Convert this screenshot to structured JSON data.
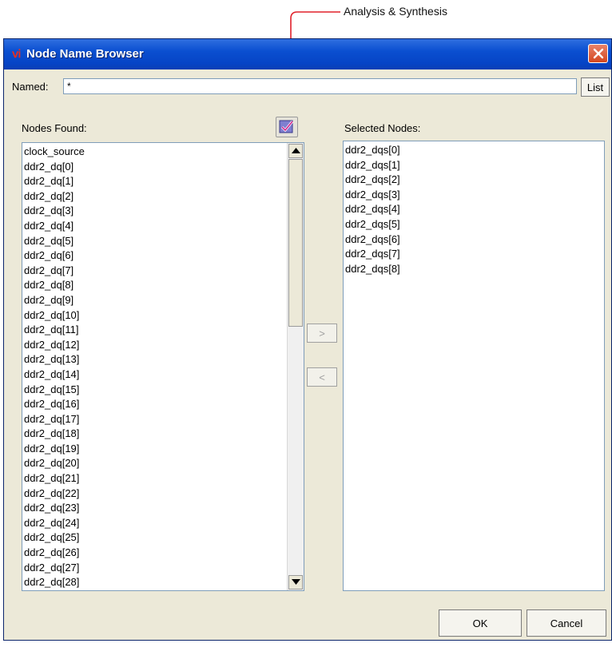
{
  "callout": {
    "label": "Analysis & Synthesis"
  },
  "window": {
    "title": "Node Name Browser",
    "app_icon": "quartus-icon",
    "close_icon": "close-icon"
  },
  "named": {
    "label": "Named:",
    "value": "*"
  },
  "list_button": {
    "label": "List"
  },
  "nodes_found": {
    "label": "Nodes Found:",
    "items": [
      "clock_source",
      "ddr2_dq[0]",
      "ddr2_dq[1]",
      "ddr2_dq[2]",
      "ddr2_dq[3]",
      "ddr2_dq[4]",
      "ddr2_dq[5]",
      "ddr2_dq[6]",
      "ddr2_dq[7]",
      "ddr2_dq[8]",
      "ddr2_dq[9]",
      "ddr2_dq[10]",
      "ddr2_dq[11]",
      "ddr2_dq[12]",
      "ddr2_dq[13]",
      "ddr2_dq[14]",
      "ddr2_dq[15]",
      "ddr2_dq[16]",
      "ddr2_dq[17]",
      "ddr2_dq[18]",
      "ddr2_dq[19]",
      "ddr2_dq[20]",
      "ddr2_dq[21]",
      "ddr2_dq[22]",
      "ddr2_dq[23]",
      "ddr2_dq[24]",
      "ddr2_dq[25]",
      "ddr2_dq[26]",
      "ddr2_dq[27]",
      "ddr2_dq[28]"
    ]
  },
  "analysis_button": {
    "icon": "analysis-synthesis-icon"
  },
  "move": {
    "right_label": ">",
    "left_label": "<"
  },
  "selected_nodes": {
    "label": "Selected Nodes:",
    "items": [
      "ddr2_dqs[0]",
      "ddr2_dqs[1]",
      "ddr2_dqs[2]",
      "ddr2_dqs[3]",
      "ddr2_dqs[4]",
      "ddr2_dqs[5]",
      "ddr2_dqs[6]",
      "ddr2_dqs[7]",
      "ddr2_dqs[8]"
    ]
  },
  "buttons": {
    "ok": "OK",
    "cancel": "Cancel"
  },
  "colors": {
    "callout_red": "#e0202a",
    "titlebar": "#0a4fd0",
    "dialog_bg": "#ece9d8"
  }
}
